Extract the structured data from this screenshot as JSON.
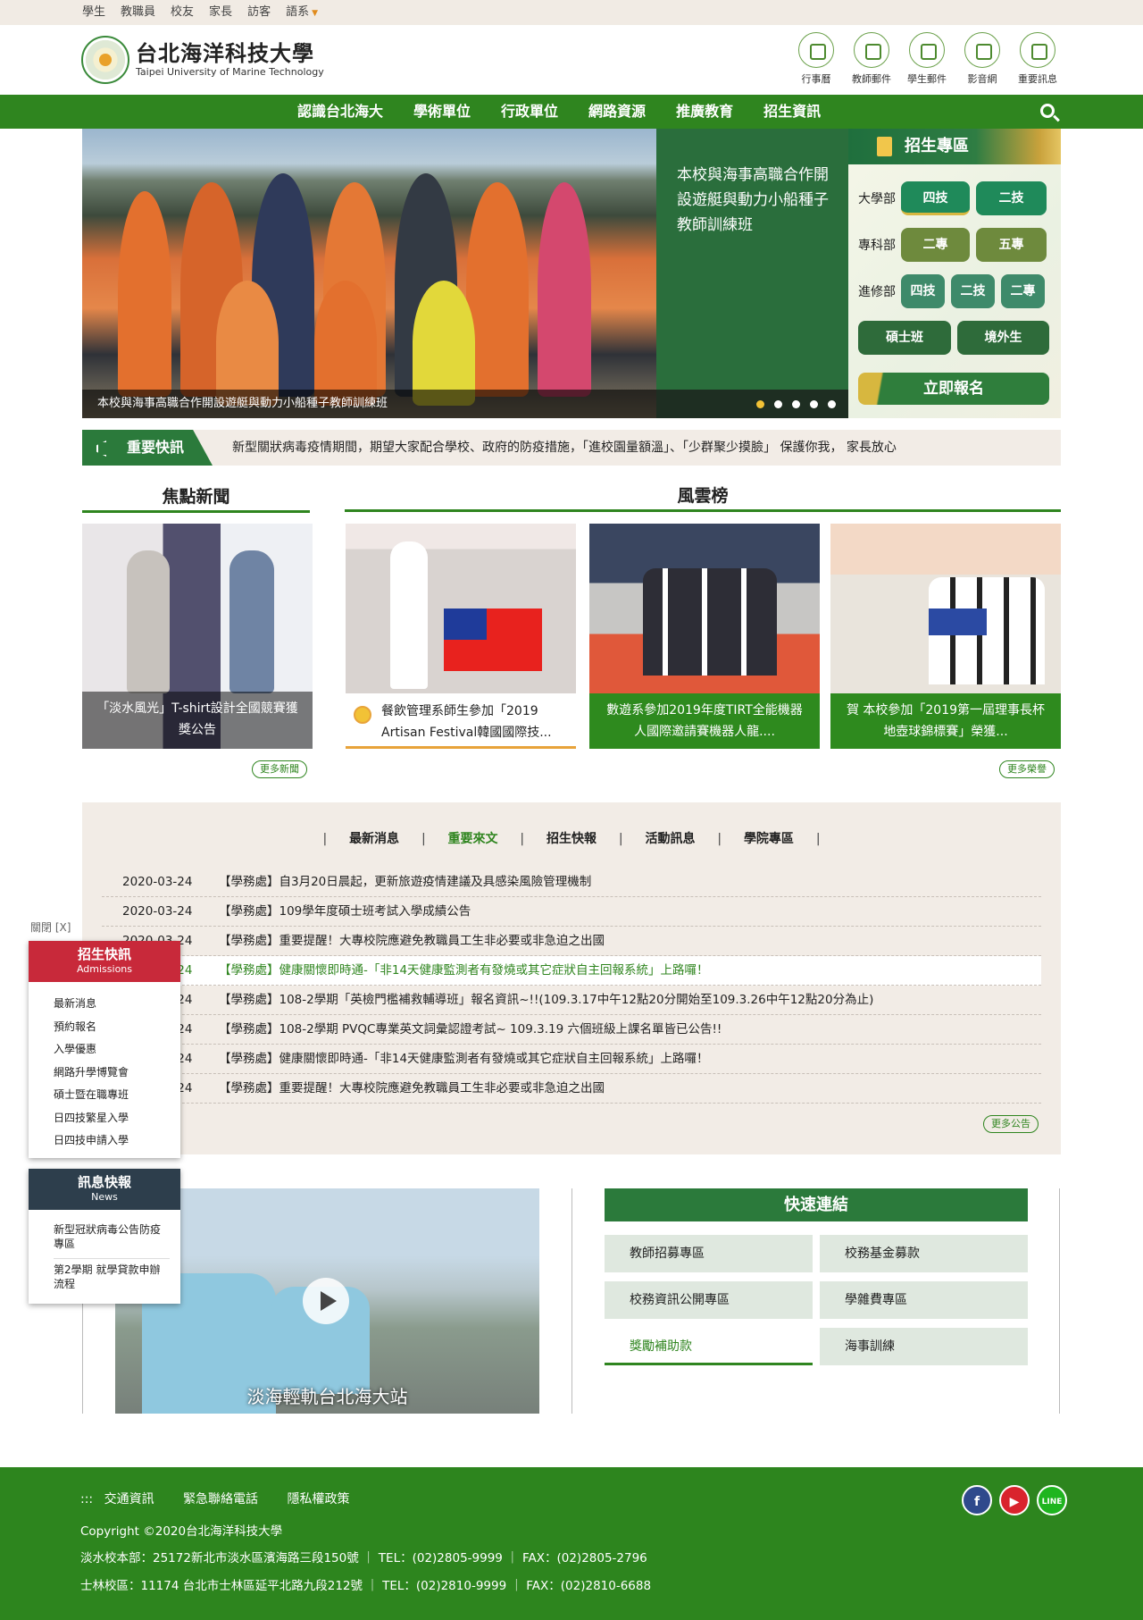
{
  "topbar": {
    "items": [
      "學生",
      "教職員",
      "校友",
      "家長",
      "訪客"
    ],
    "lang": "語系"
  },
  "header": {
    "logo_cn": "台北海洋科技大學",
    "logo_en": "Taipei University of Marine Technology",
    "quick": [
      {
        "label": "行事曆",
        "icon": "calendar-icon"
      },
      {
        "label": "教師郵件",
        "icon": "teacher-mail-icon"
      },
      {
        "label": "學生郵件",
        "icon": "student-mail-icon"
      },
      {
        "label": "影音網",
        "icon": "video-icon"
      },
      {
        "label": "重要訊息",
        "icon": "bell-icon"
      }
    ]
  },
  "nav": {
    "items": [
      "認識台北海大",
      "學術單位",
      "行政單位",
      "網路資源",
      "推廣教育",
      "招生資訊"
    ]
  },
  "hero": {
    "caption": "本校與海事高職合作開設遊艇與動力小船種子教師訓練班",
    "text": "本校與海事高職合作開設遊艇與動力小船種子教師訓練班",
    "slides": 5,
    "active_slide": 1
  },
  "admissions": {
    "title": "招生專區",
    "rows": [
      {
        "label": "大學部",
        "buttons": [
          "四技",
          "二技"
        ]
      },
      {
        "label": "專科部",
        "buttons": [
          "二專",
          "五專"
        ]
      },
      {
        "label": "進修部",
        "buttons": [
          "四技",
          "二技",
          "二專"
        ]
      }
    ],
    "extra": [
      "碩士班",
      "境外生"
    ],
    "apply": "立即報名"
  },
  "ticker": {
    "label": "重要快訊",
    "message": "新型關狀病毒疫情期間，期望大家配合學校、政府的防疫措施，「進校園量額溫」、「少群聚少摸臉」 保護你我， 家長放心"
  },
  "focus": {
    "title": "焦點新聞",
    "card": "「淡水風光」T-shirt設計全國競賽獲獎公告",
    "more": "更多新聞"
  },
  "honor": {
    "title": "風雲榜",
    "cards": [
      "餐飲管理系師生參加「2019 Artisan Festival韓國國際技...",
      "數遊系參加2019年度TIRT全能機器人國際邀請賽機器人龍....",
      "賀 本校參加「2019第一屆理事長杯地壺球錦標賽」榮獲..."
    ],
    "more": "更多榮譽"
  },
  "announcements": {
    "tabs": [
      "最新消息",
      "重要來文",
      "招生快報",
      "活動訊息",
      "學院專區"
    ],
    "active_tab": "重要來文",
    "items": [
      {
        "date": "2020-03-24",
        "text": "【學務處】自3月20日晨起，更新旅遊疫情建議及具感染風險管理機制"
      },
      {
        "date": "2020-03-24",
        "text": "【學務處】109學年度碩士班考試入學成績公告"
      },
      {
        "date": "2020-03-24",
        "text": "【學務處】重要提醒！大專校院應避免教職員工生非必要或非急迫之出國"
      },
      {
        "date": "2020-03-24",
        "text": "【學務處】健康關懷即時通-「非14天健康監測者有發燒或其它症狀自主回報系統」上路囉！"
      },
      {
        "date": "2020-03-24",
        "text": "【學務處】108-2學期「英檢門檻補救輔導班」報名資訊~!!(109.3.17中午12點20分開始至109.3.26中午12點20分為止)"
      },
      {
        "date": "2020-03-24",
        "text": "【學務處】108-2學期 PVQC專業英文詞彙認證考試~ 109.3.19 六個班級上課名單皆已公告!!"
      },
      {
        "date": "2020-03-24",
        "text": "【學務處】健康關懷即時通-「非14天健康監測者有發燒或其它症狀自主回報系統」上路囉！"
      },
      {
        "date": "2020-03-24",
        "text": "【學務處】重要提醒！大專校院應避免教職員工生非必要或非急迫之出國"
      }
    ],
    "highlight_index": 3,
    "more": "更多公告"
  },
  "video": {
    "title": "淡海輕軌台北海大站"
  },
  "quicklinks": {
    "title": "快速連結",
    "items": [
      "教師招募專區",
      "校務基金募款",
      "校務資訊公開專區",
      "學雜費專區",
      "獎勵補助款",
      "海事訓練"
    ],
    "active": "獎勵補助款"
  },
  "float": {
    "close": "關閉 [X]",
    "adm_title": "招生快訊",
    "adm_sub": "Admissions",
    "adm_items": [
      "最新消息",
      "預約報名",
      "入學優惠",
      "網路升學博覽會",
      "碩士暨在職專班",
      "日四技繁星入學",
      "日四技申請入學"
    ],
    "news_title": "訊息快報",
    "news_sub": "News",
    "news_items": [
      "新型冠狀病毒公告防疫專區",
      "第2學期 就學貸款申辦流程"
    ]
  },
  "footer": {
    "links": [
      "交通資訊",
      "緊急聯絡電話",
      "隱私權政策"
    ],
    "copyright": "Copyright ©2020台北海洋科技大學",
    "addr1": "淡水校本部：25172新北市淡水區濱海路三段150號 ｜ TEL：(02)2805-9999 ｜ FAX：(02)2805-2796",
    "addr2": "士林校區：11174 台北市士林區延平北路九段212號 ｜ TEL：(02)2810-9999 ｜ FAX：(02)2810-6688",
    "social": [
      {
        "name": "facebook",
        "icon": "facebook-icon"
      },
      {
        "name": "youtube",
        "icon": "youtube-icon"
      },
      {
        "name": "line",
        "icon": "line-icon"
      }
    ]
  },
  "colors": {
    "primary_green": "#2f851f",
    "dark_green": "#2a6e3c",
    "beige": "#f2ece6",
    "red": "#c8293a",
    "navy": "#2d3e4c",
    "gold": "#f2c236"
  }
}
